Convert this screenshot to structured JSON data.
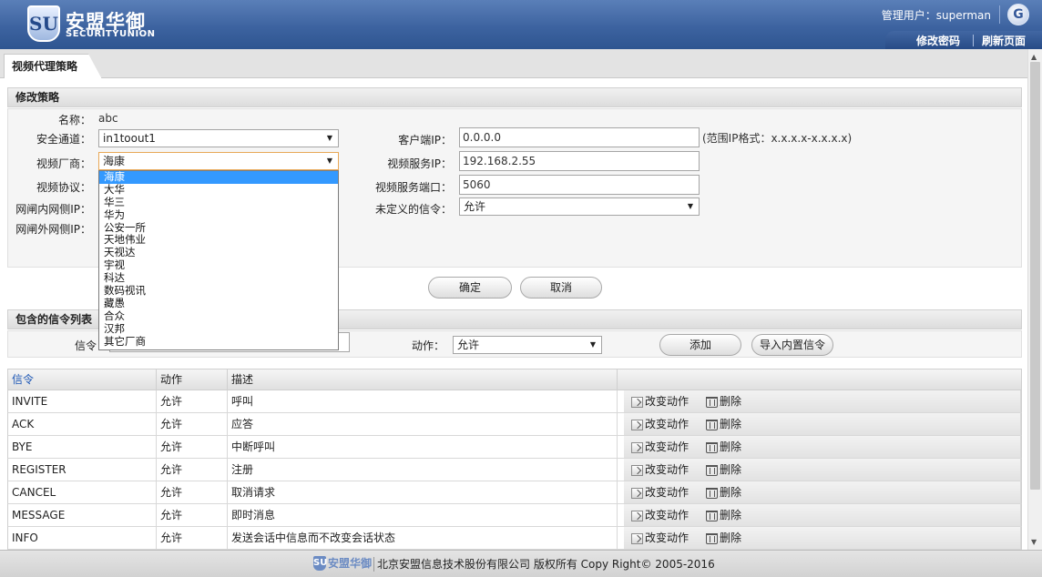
{
  "brand": {
    "name_cn": "安盟华御",
    "name_en": "SECURITYUNION",
    "logo_letter": "SU"
  },
  "header": {
    "user_label": "管理用户：superman",
    "logout_glyph": "G",
    "links": [
      "修改密码",
      "刷新页面"
    ]
  },
  "tab": {
    "label": "视频代理策略"
  },
  "edit_section": {
    "title": "修改策略",
    "name_label": "名称：",
    "name_value": "abc",
    "channel_label": "安全通道：",
    "channel_value": "in1toout1",
    "vendor_label": "视频厂商：",
    "vendor_value": "海康",
    "protocol_label": "视频协议：",
    "gap_in_label": "网闸内网侧IP：",
    "gap_out_label": "网闸外网侧IP：",
    "client_ip_label": "客户端IP：",
    "client_ip_value": "0.0.0.0",
    "client_ip_hint": "(范围IP格式：x.x.x.x-x.x.x.x)",
    "server_ip_label": "视频服务IP：",
    "server_ip_value": "192.168.2.55",
    "server_port_label": "视频服务端口：",
    "server_port_value": "5060",
    "undefined_cmd_label": "未定义的信令：",
    "undefined_cmd_value": "允许",
    "confirm_label": "确定",
    "cancel_label": "取消"
  },
  "vendor_dropdown": {
    "options": [
      "海康",
      "大华",
      "华三",
      "华为",
      "公安一所",
      "天地伟业",
      "天视达",
      "宇视",
      "科达",
      "数码视讯",
      "藏愚",
      "合众",
      "汉邦",
      "其它厂商"
    ],
    "selected_index": 0
  },
  "signal_section": {
    "title": "包含的信令列表",
    "signal_label": "信令",
    "action_label": "动作：",
    "action_value": "允许",
    "add_label": "添加",
    "import_label": "导入内置信令"
  },
  "table": {
    "columns": [
      "信令",
      "动作",
      "描述",
      ""
    ],
    "rows": [
      {
        "signal": "INVITE",
        "action": "允许",
        "desc": "呼叫"
      },
      {
        "signal": "ACK",
        "action": "允许",
        "desc": "应答"
      },
      {
        "signal": "BYE",
        "action": "允许",
        "desc": "中断呼叫"
      },
      {
        "signal": "REGISTER",
        "action": "允许",
        "desc": "注册"
      },
      {
        "signal": "CANCEL",
        "action": "允许",
        "desc": "取消请求"
      },
      {
        "signal": "MESSAGE",
        "action": "允许",
        "desc": "即时消息"
      },
      {
        "signal": "INFO",
        "action": "允许",
        "desc": "发送会话中信息而不改变会话状态"
      }
    ],
    "edit_label": "改变动作",
    "delete_label": "删除"
  },
  "footer": {
    "logo_text": "安盟华御",
    "copyright": "北京安盟信息技术股份有限公司 版权所有 Copy Right© 2005-2016"
  }
}
